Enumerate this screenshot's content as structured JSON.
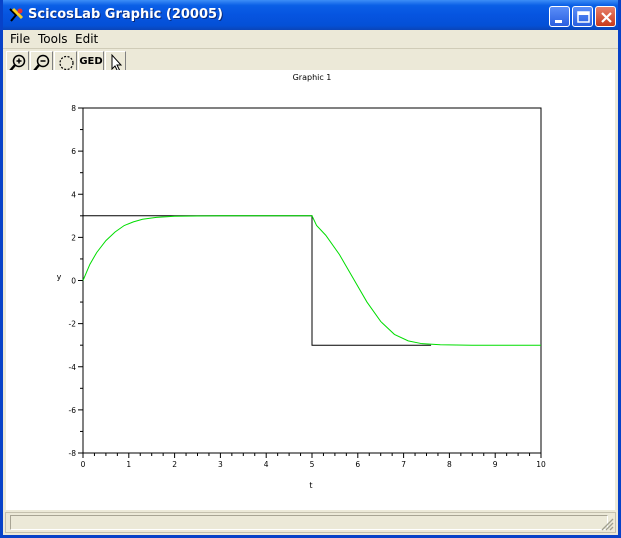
{
  "window": {
    "title": "ScicosLab Graphic (20005)",
    "buttons": [
      "minimize",
      "maximize",
      "close"
    ]
  },
  "menu": [
    "File",
    "Tools",
    "Edit"
  ],
  "toolbar": {
    "icons": [
      "zoom-in-icon",
      "zoom-out-icon",
      "rotate-icon",
      "ged",
      "pointer-icon"
    ],
    "ged_label": "GED"
  },
  "colors": {
    "input": "#000000",
    "output": "#00dd00"
  },
  "chart_data": {
    "type": "line",
    "title": "Graphic 1",
    "xlabel": "t",
    "ylabel": "y",
    "xlim": [
      0,
      10
    ],
    "ylim": [
      -8,
      8
    ],
    "xticks": [
      0,
      1,
      2,
      3,
      4,
      5,
      6,
      7,
      8,
      9,
      10
    ],
    "yticks": [
      -8,
      -6,
      -4,
      -2,
      0,
      2,
      4,
      6,
      8
    ],
    "grid": false,
    "series": [
      {
        "color": "#000000",
        "x": [
          0,
          1.8,
          1.8,
          5,
          5,
          5,
          7.6
        ],
        "y": [
          3,
          3,
          3,
          3,
          3,
          -3,
          -3
        ]
      },
      {
        "color": "#00dd00",
        "x": [
          0,
          0.15,
          0.3,
          0.5,
          0.7,
          0.9,
          1.1,
          1.3,
          1.6,
          2,
          3,
          4,
          5,
          5.1,
          5.3,
          5.6,
          5.9,
          6.2,
          6.5,
          6.8,
          7.1,
          7.4,
          7.8,
          8.5,
          10
        ],
        "y": [
          0,
          0.75,
          1.3,
          1.85,
          2.25,
          2.55,
          2.72,
          2.84,
          2.93,
          2.98,
          3,
          3,
          3,
          2.55,
          2.1,
          1.2,
          0.1,
          -1.0,
          -1.9,
          -2.5,
          -2.8,
          -2.93,
          -2.98,
          -3,
          -3
        ]
      }
    ]
  }
}
